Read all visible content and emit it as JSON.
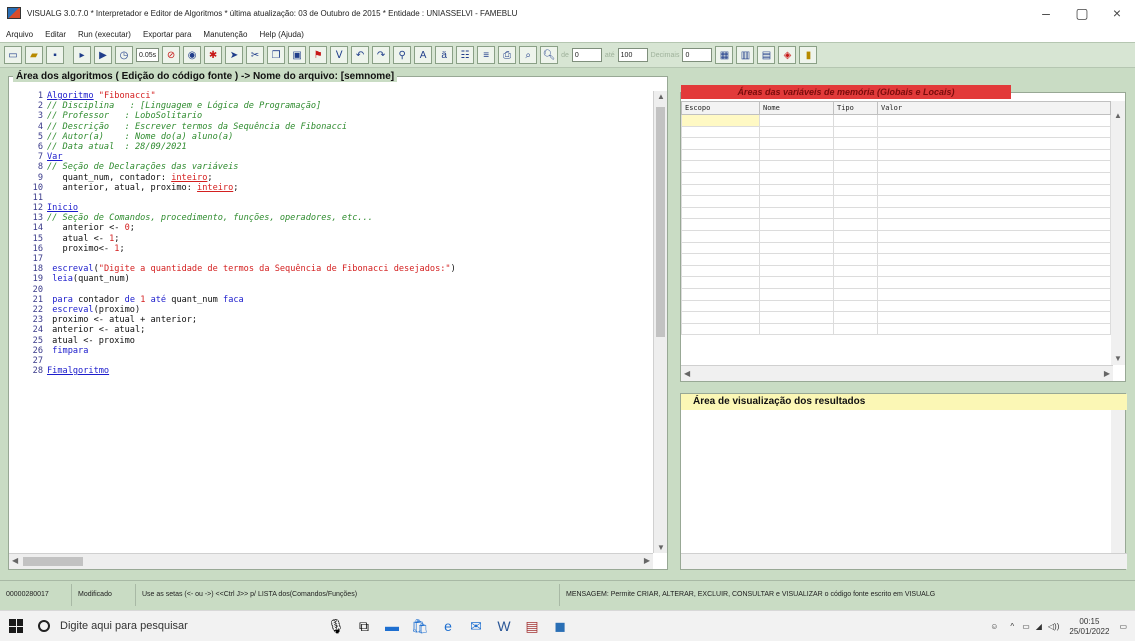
{
  "window": {
    "title": "VISUALG 3.0.7.0 * Interpretador e Editor de Algoritmos * última atualização: 03 de Outubro de 2015 * Entidade : UNIASSELVI - FAMEBLU",
    "minimize": "–",
    "maximize": "▢",
    "close": "×"
  },
  "menu": [
    "Arquivo",
    "Editar",
    "Run (executar)",
    "Exportar para",
    "Manutenção",
    "Help (Ajuda)"
  ],
  "toolbar": {
    "speed": "0.05s",
    "field1": "0",
    "field2": "100",
    "decimal_label": "Decimais",
    "decimal_value": "0"
  },
  "editor": {
    "title": "Área dos algoritmos ( Edição do código fonte ) -> Nome do arquivo: [semnome]",
    "lines": [
      {
        "n": "1",
        "parts": [
          [
            "kw",
            "Algoritmo"
          ],
          [
            "tx",
            " "
          ],
          [
            "st",
            "\"Fibonacci\""
          ]
        ]
      },
      {
        "n": "2",
        "parts": [
          [
            "cm",
            "// Disciplina   : [Linguagem e Lógica de Programação]"
          ]
        ]
      },
      {
        "n": "3",
        "parts": [
          [
            "cm",
            "// Professor   : LoboSolitario"
          ]
        ]
      },
      {
        "n": "4",
        "parts": [
          [
            "cm",
            "// Descrição   : Escrever termos da Sequência de Fibonacci"
          ]
        ]
      },
      {
        "n": "5",
        "parts": [
          [
            "cm",
            "// Autor(a)    : Nome do(a) aluno(a)"
          ]
        ]
      },
      {
        "n": "6",
        "parts": [
          [
            "cm",
            "// Data atual  : 28/09/2021"
          ]
        ]
      },
      {
        "n": "7",
        "parts": [
          [
            "kw",
            "Var"
          ]
        ]
      },
      {
        "n": "8",
        "parts": [
          [
            "cm",
            "// Seção de Declarações das variáveis"
          ]
        ]
      },
      {
        "n": "9",
        "parts": [
          [
            "tx",
            "   quant_num, contador: "
          ],
          [
            "type",
            "inteiro"
          ],
          [
            "tx",
            ";"
          ]
        ]
      },
      {
        "n": "10",
        "parts": [
          [
            "tx",
            "   anterior, atual, proximo: "
          ],
          [
            "type",
            "inteiro"
          ],
          [
            "tx",
            ";"
          ]
        ]
      },
      {
        "n": "11",
        "parts": []
      },
      {
        "n": "12",
        "parts": [
          [
            "kw",
            "Inicio"
          ]
        ]
      },
      {
        "n": "13",
        "parts": [
          [
            "cm",
            "// Seção de Comandos, procedimento, funções, operadores, etc..."
          ]
        ]
      },
      {
        "n": "14",
        "parts": [
          [
            "tx",
            "   anterior <- "
          ],
          [
            "num",
            "0"
          ],
          [
            "tx",
            ";"
          ]
        ]
      },
      {
        "n": "15",
        "parts": [
          [
            "tx",
            "   atual <- "
          ],
          [
            "num",
            "1"
          ],
          [
            "tx",
            ";"
          ]
        ]
      },
      {
        "n": "16",
        "parts": [
          [
            "tx",
            "   proximo<- "
          ],
          [
            "num",
            "1"
          ],
          [
            "tx",
            ";"
          ]
        ]
      },
      {
        "n": "17",
        "parts": []
      },
      {
        "n": "18",
        "parts": [
          [
            "tx",
            " "
          ],
          [
            "kw2",
            "escreval"
          ],
          [
            "tx",
            "("
          ],
          [
            "st",
            "\"Digite a quantidade de termos da Sequência de Fibonacci desejados:\""
          ],
          [
            "tx",
            ")"
          ]
        ]
      },
      {
        "n": "19",
        "parts": [
          [
            "tx",
            " "
          ],
          [
            "kw2",
            "leia"
          ],
          [
            "tx",
            "(quant_num)"
          ]
        ]
      },
      {
        "n": "20",
        "parts": []
      },
      {
        "n": "21",
        "parts": [
          [
            "tx",
            " "
          ],
          [
            "kw2",
            "para"
          ],
          [
            "tx",
            " contador "
          ],
          [
            "kw2",
            "de"
          ],
          [
            "tx",
            " "
          ],
          [
            "num",
            "1"
          ],
          [
            "tx",
            " "
          ],
          [
            "kw2",
            "até"
          ],
          [
            "tx",
            " quant_num "
          ],
          [
            "kw2",
            "faca"
          ]
        ]
      },
      {
        "n": "22",
        "parts": [
          [
            "tx",
            " "
          ],
          [
            "kw2",
            "escreval"
          ],
          [
            "tx",
            "(proximo)"
          ]
        ]
      },
      {
        "n": "23",
        "parts": [
          [
            "tx",
            " proximo <- atual + anterior;"
          ]
        ]
      },
      {
        "n": "24",
        "parts": [
          [
            "tx",
            " anterior <- atual;"
          ]
        ]
      },
      {
        "n": "25",
        "parts": [
          [
            "tx",
            " atual <- proximo"
          ]
        ]
      },
      {
        "n": "26",
        "parts": [
          [
            "tx",
            " "
          ],
          [
            "kw2",
            "fimpara"
          ]
        ]
      },
      {
        "n": "27",
        "parts": []
      },
      {
        "n": "28",
        "parts": [
          [
            "kw",
            "Fimalgoritmo"
          ]
        ]
      }
    ]
  },
  "variables": {
    "title": "Áreas das variáveis de memória (Globais e Locais)",
    "columns": [
      "Escopo",
      "Nome",
      "Tipo",
      "Valor"
    ]
  },
  "results": {
    "title": "Área de visualização dos resultados"
  },
  "status": {
    "position": "00000280017",
    "state": "Modificado",
    "hint": "Use as setas (<- ou ->) <<Ctrl J>> p/ LISTA dos(Comandos/Funções)",
    "message": "MENSAGEM: Permite CRIAR, ALTERAR, EXCLUIR, CONSULTAR e VISUALIZAR o código fonte escrito em VISUALG"
  },
  "taskbar": {
    "search_placeholder": "Digite aqui para pesquisar",
    "time": "00:15",
    "date": "25/01/2022"
  },
  "colors": {
    "background": "#c9dcc4",
    "var_title_bg": "#e23a3a",
    "results_title_bg": "#fbf7b5",
    "keyword": "#1c1ccc",
    "comment": "#2e8b2e",
    "string": "#d42020"
  }
}
